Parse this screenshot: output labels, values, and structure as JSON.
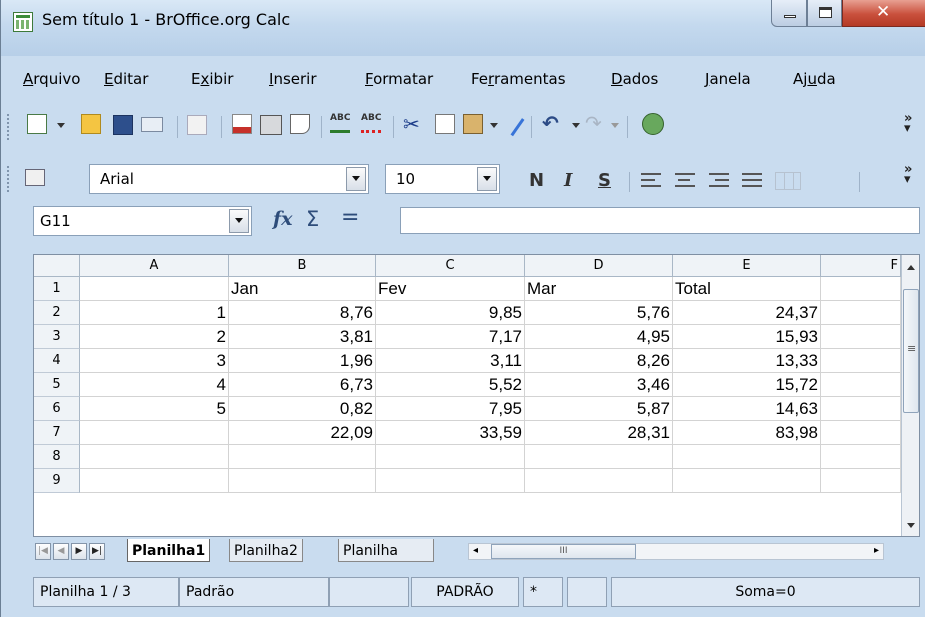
{
  "window": {
    "title": "Sem título 1 - BrOffice.org Calc"
  },
  "menu": [
    {
      "pre": "",
      "u": "A",
      "post": "rquivo"
    },
    {
      "pre": "",
      "u": "E",
      "post": "ditar"
    },
    {
      "pre": "E",
      "u": "x",
      "post": "ibir"
    },
    {
      "pre": "",
      "u": "I",
      "post": "nserir"
    },
    {
      "pre": "",
      "u": "F",
      "post": "ormatar"
    },
    {
      "pre": "Fe",
      "u": "r",
      "post": "ramentas"
    },
    {
      "pre": "",
      "u": "D",
      "post": "ados"
    },
    {
      "pre": "",
      "u": "J",
      "post": "anela"
    },
    {
      "pre": "Aj",
      "u": "u",
      "post": "da"
    }
  ],
  "format": {
    "font_name": "Arial",
    "font_size": "10",
    "bold": "N",
    "italic": "I",
    "underline": "S"
  },
  "formula": {
    "name_box": "G11",
    "function_glyph": "fx",
    "sum_glyph": "Σ",
    "equals_glyph": "=",
    "input_value": ""
  },
  "sheet": {
    "columns": [
      "A",
      "B",
      "C",
      "D",
      "E",
      "F"
    ],
    "rows": [
      "1",
      "2",
      "3",
      "4",
      "5",
      "6",
      "7",
      "8",
      "9"
    ],
    "cells": [
      [
        "",
        "Jan",
        "Fev",
        "Mar",
        "Total"
      ],
      [
        "1",
        "8,76",
        "9,85",
        "5,76",
        "24,37"
      ],
      [
        "2",
        "3,81",
        "7,17",
        "4,95",
        "15,93"
      ],
      [
        "3",
        "1,96",
        "3,11",
        "8,26",
        "13,33"
      ],
      [
        "4",
        "6,73",
        "5,52",
        "3,46",
        "15,72"
      ],
      [
        "5",
        "0,82",
        "7,95",
        "5,87",
        "14,63"
      ],
      [
        "",
        "22,09",
        "33,59",
        "28,31",
        "83,98"
      ],
      [
        "",
        "",
        "",
        "",
        ""
      ],
      [
        "",
        "",
        "",
        "",
        ""
      ]
    ]
  },
  "tabs": {
    "sheets": [
      "Planilha1",
      "Planilha2",
      "Planilha"
    ],
    "active_index": 0,
    "hscroll_glyph": "III"
  },
  "status": {
    "sheet_info": "Planilha 1 / 3",
    "page_style": "Padrão",
    "mode": "PADRÃO",
    "modified": "*",
    "sum": "Soma=0"
  },
  "icons": {
    "toolbar_standard": [
      "new-doc-icon",
      "open-folder-icon",
      "save-icon",
      "email-icon",
      "edit-file-icon",
      "export-pdf-icon",
      "print-icon",
      "page-preview-icon",
      "spellcheck-icon",
      "autospellcheck-icon",
      "cut-icon",
      "copy-icon",
      "paste-icon",
      "format-paintbrush-icon",
      "undo-icon",
      "redo-icon",
      "navigator-icon"
    ]
  },
  "colors": {
    "title_bar": "#c4d9ee",
    "close_button": "#c9503c",
    "sheet_grid": "#d3d3d3"
  }
}
